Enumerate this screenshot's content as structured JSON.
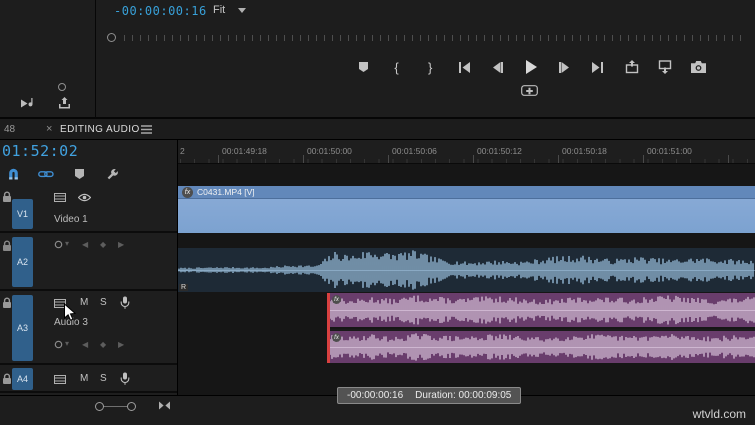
{
  "colors": {
    "accent_blue": "#3f8fd4",
    "timecode_blue": "#41a2e0",
    "video_clip": "#83a6d3",
    "audio_clip_purple": "#693d6c",
    "trim_red": "#d84040"
  },
  "program_monitor": {
    "timecode": "-00:00:00:16",
    "zoom_level": "Fit",
    "mark_in_glyph": "{",
    "mark_out_glyph": "}"
  },
  "timeline": {
    "tab_prefix": "48",
    "tab_close_glyph": "×",
    "tab_title": "EDITING AUDIO",
    "playhead_timecode": "01:52:02",
    "ruler_partial": "2",
    "ruler_labels": [
      "00:01:49:18",
      "00:01:50:00",
      "00:01:50:06",
      "00:01:50:12",
      "00:01:50:18",
      "00:01:51:00"
    ],
    "mute_label": "M",
    "solo_label": "S",
    "tracks": {
      "v1": {
        "id": "V1",
        "name": "Video 1"
      },
      "a2": {
        "id": "A2"
      },
      "a3": {
        "id": "A3",
        "name": "Audio 3"
      },
      "a4": {
        "id": "A4"
      }
    },
    "video_clip": {
      "fx_badge": "fx",
      "label": "C0431.MP4 [V]"
    },
    "audio_clip": {
      "fx_badge": "fx",
      "left_label": "R"
    },
    "tooltip": {
      "offset": "-00:00:00:16",
      "duration": "Duration: 00:00:09:05"
    }
  },
  "glyphs": {
    "kf_prev": "◀",
    "kf_diamond": "◆",
    "kf_next": "▶",
    "dropdown": "▾"
  },
  "watermark": "wtvld.com"
}
